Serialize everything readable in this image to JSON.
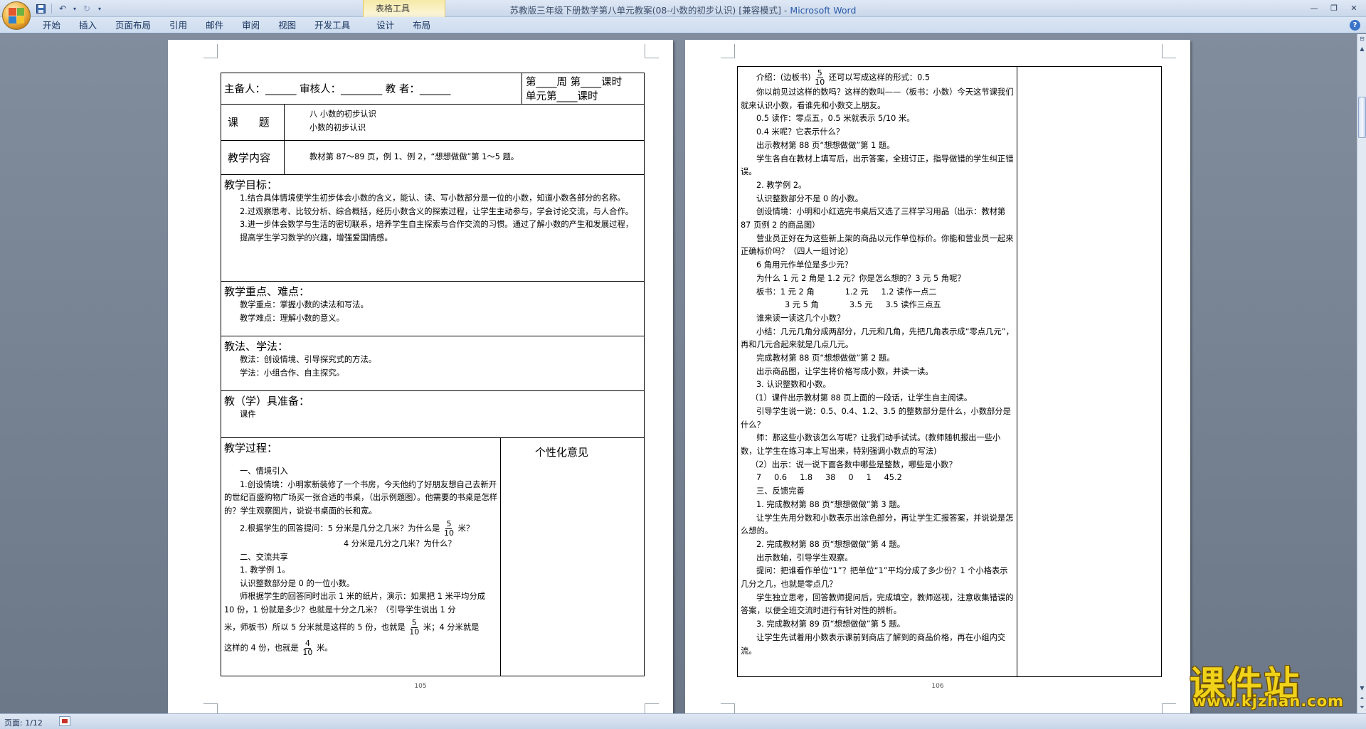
{
  "window": {
    "title": "苏教版三年级下册数学第八单元教案(08-小数的初步认识) [兼容模式] - ",
    "app_name": "Microsoft Word",
    "context_tab_group": "表格工具"
  },
  "ribbon": {
    "tabs": [
      "开始",
      "插入",
      "页面布局",
      "引用",
      "邮件",
      "审阅",
      "视图",
      "开发工具",
      "设计",
      "布局"
    ]
  },
  "left_page": {
    "header_row": {
      "left": "主备人：______ 审核人：________  教  者：______",
      "right_line1": "第____周 第____课时",
      "right_line2": "单元第____课时"
    },
    "topic": {
      "label": "课      题",
      "line1": "八  小数的初步认识",
      "line2": "小数的初步认识"
    },
    "content": {
      "label": "教学内容",
      "text": "教材第 87～89 页，例 1、例 2，“想想做做”第 1～5 题。"
    },
    "objectives": {
      "heading": "教学目标：",
      "items": [
        "1.结合具体情境使学生初步体会小数的含义，能认、读、写小数部分是一位的小数，知道小数各部分的名称。",
        "2.过观察思考、比较分析、综合概括，经历小数含义的探索过程，让学生主动参与，学会讨论交流，与人合作。",
        "3.进一步体会数学与生活的密切联系，培养学生自主探索与合作交流的习惯。通过了解小数的产生和发展过程，提高学生学习数学的兴趣，增强爱国情感。"
      ]
    },
    "key_points": {
      "heading": "教学重点、难点：",
      "items": [
        "教学重点：掌握小数的读法和写法。",
        "教学难点：理解小数的意义。"
      ]
    },
    "methods": {
      "heading": "教法、学法：",
      "items": [
        "教法：创设情境、引导探究式的方法。",
        "学法：小组合作、自主探究。"
      ]
    },
    "tools": {
      "heading": "教（学）具准备：",
      "items": [
        "课件"
      ]
    },
    "process": {
      "heading": "教学过程：",
      "side_heading": "个性化意见",
      "sec1": "一、情境引入",
      "p1": "1.创设情境：小明家新装修了一个书房，今天他约了好朋友想自己去新开的世纪百盛购物广场买一张合适的书桌，（出示例题图）。他需要的书桌是怎样的？学生观察图片，说说书桌面的长和宽。",
      "p2a": "2.根据学生的回答提问：5 分米是几分之几米？为什么是",
      "p2b": "米？",
      "p3": "4 分米是几分之几米？为什么？",
      "sec2": "二、交流共享",
      "p4": "1. 教学例 1。",
      "p5": "认识整数部分是 0 的一位小数。",
      "p6": "师根据学生的回答同时出示 1 米的纸片，演示：如果把 1 米平均分成 10 份，1 份就是多少？也就是十分之几米？（引导学生说出 1 分",
      "p7a": "米，师板书）所以 5 分米就是这样的 5 份，也就是",
      "p7b": "米；4 分米就是",
      "p8a": "这样的 4 份，也就是",
      "p8b": "米。",
      "frac_5": "5",
      "frac_4": "4",
      "frac_den": "10"
    },
    "page_number": "105"
  },
  "right_page": {
    "lines": {
      "l1a": "介绍：(边板书)",
      "l1b": "还可以写成这样的形式：0.5",
      "l2": "你以前见过这样的数吗？这样的数叫——（板书：小数）今天这节课我们就来认识小数，看谁先和小数交上朋友。",
      "l3": "0.5 读作：零点五，0.5 米就表示 5/10 米。",
      "l4": "0.4 米呢？它表示什么？",
      "l5": "出示教材第 88 页“想想做做”第 1 题。",
      "l6": "学生各自在教材上填写后，出示答案，全班订正，指导做错的学生纠正错误。",
      "l7": "2. 教学例 2。",
      "l8": "认识整数部分不是 0 的小数。",
      "l9": "创设情境：小明和小红选完书桌后又选了三样学习用品（出示：教材第 87 页例 2 的商品图）",
      "l10": "营业员正好在为这些新上架的商品以元作单位标价。你能和营业员一起来正确标价吗？（四人一组讨论）",
      "l11": "6 角用元作单位是多少元？",
      "l12": "为什么 1 元 2 角是 1.2 元？你是怎么想的？3 元 5 角呢？",
      "l13": "板书：1 元 2 角            1.2 元     1.2 读作一点二",
      "l14": "3 元 5 角            3.5 元     3.5 读作三点五",
      "l15": "谁来读一读这几个小数？",
      "l16": "小结：几元几角分成两部分，几元和几角，先把几角表示成“零点几元”，再和几元合起来就是几点几元。",
      "l17": "完成教材第 88 页“想想做做”第 2 题。",
      "l18": "出示商品图，让学生将价格写成小数，并读一读。",
      "l19": "3. 认识整数和小数。",
      "l20": "（1）课件出示教材第 88 页上面的一段话，让学生自主阅读。",
      "l21": "引导学生说一说：0.5、0.4、1.2、3.5 的整数部分是什么，小数部分是什么？",
      "l22": "师：那这些小数该怎么写呢？让我们动手试试。(教师随机报出一些小数，让学生在练习本上写出来，特别强调小数点的写法)",
      "l23": "（2）出示：说一说下面各数中哪些是整数，哪些是小数？",
      "l24": "7     0.6     1.8     38     0     1     45.2",
      "l25": "三、反馈完善",
      "l26": "1. 完成教材第 88 页“想想做做”第 3 题。",
      "l27": "让学生先用分数和小数表示出涂色部分，再让学生汇报答案，并说说是怎么想的。",
      "l28": "2. 完成教材第 88 页“想想做做”第 4 题。",
      "l29": "出示数轴，引导学生观察。",
      "l30": "提问：把谁看作单位“1”？把单位“1”平均分成了多少份？1 个小格表示几分之几，也就是零点几？",
      "l31": "学生独立思考，回答教师提问后，完成填空，教师巡视，注意收集错误的答案，以便全班交流时进行有针对性的辨析。",
      "l32": "3. 完成教材第 89 页“想想做做”第 5 题。",
      "l33": "让学生先试着用小数表示课前到商店了解到的商品价格，再在小组内交流。",
      "frac_num": "5",
      "frac_den": "10"
    },
    "page_number": "106"
  },
  "statusbar": {
    "page_info": "页面: 1/12"
  },
  "watermark": {
    "text": "课件站",
    "url": "www.kjzhan.com"
  },
  "colors": {
    "ribbon_bg": "#cddcef",
    "canvas_bg": "#6f7b8b",
    "watermark": "#f0d21a"
  }
}
